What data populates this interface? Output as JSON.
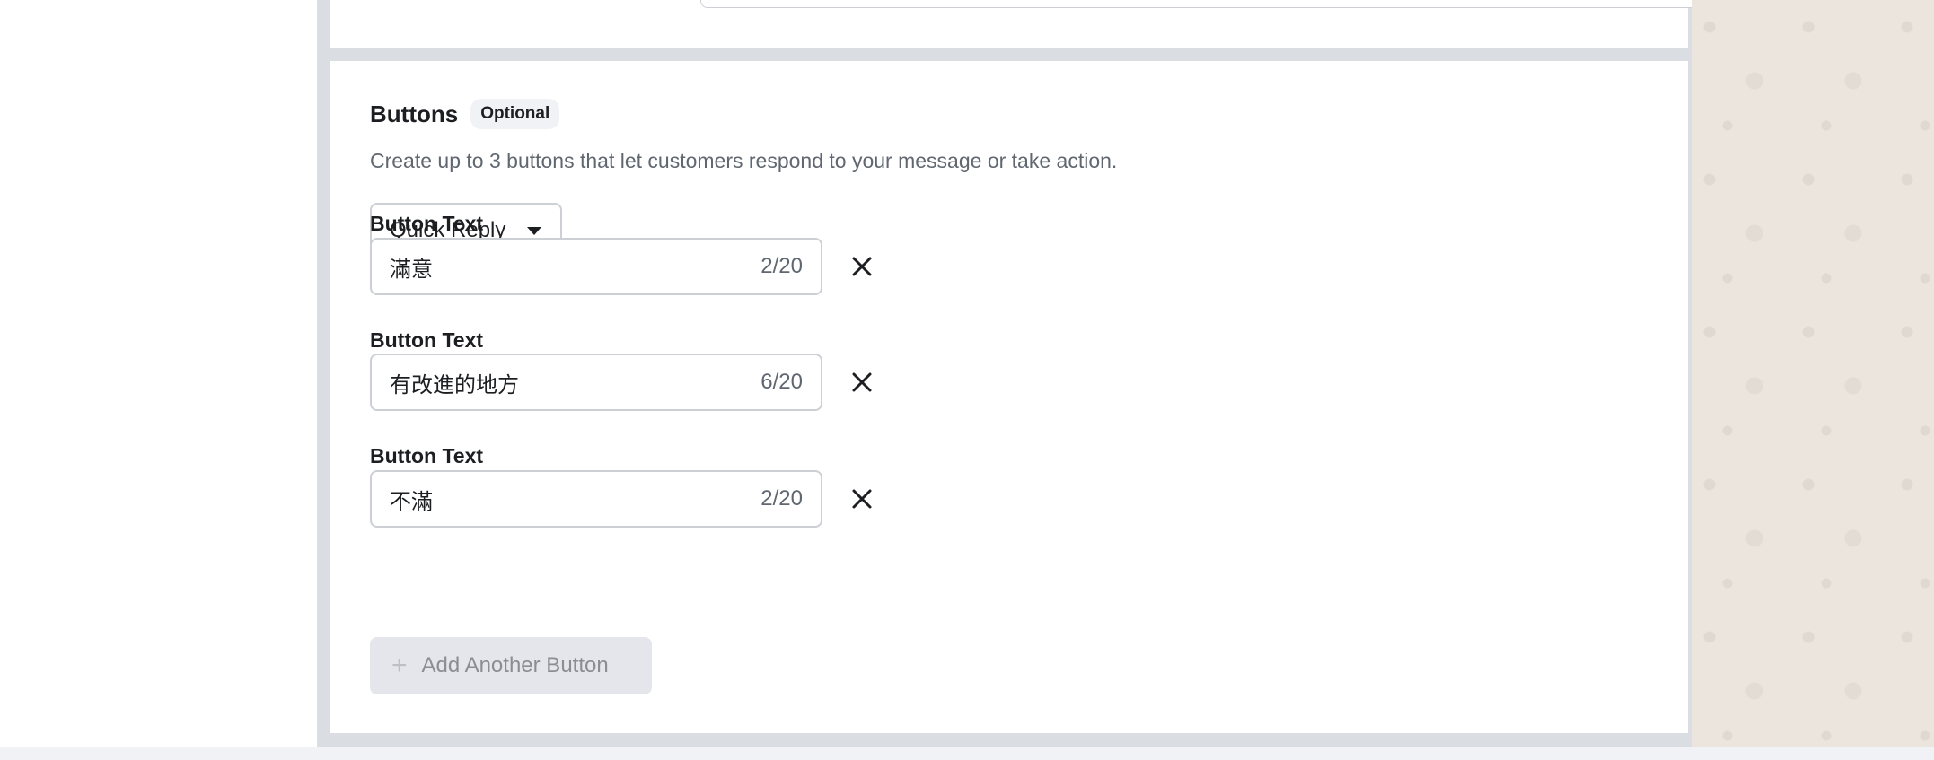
{
  "section": {
    "title": "Buttons",
    "badge": "Optional",
    "description": "Create up to 3 buttons that let customers respond to your message or take action."
  },
  "button_type": {
    "selected": "Quick Reply"
  },
  "buttons": [
    {
      "label": "Button Text",
      "value": "滿意",
      "count": "2/20"
    },
    {
      "label": "Button Text",
      "value": "有改進的地方",
      "count": "6/20"
    },
    {
      "label": "Button Text",
      "value": "不滿",
      "count": "2/20"
    }
  ],
  "add_button": {
    "label": "Add Another Button",
    "enabled": false
  },
  "icons": {
    "remove": "close-icon",
    "add": "plus-icon",
    "dropdown": "caret-down-icon"
  },
  "colors": {
    "text": "#1c1e21",
    "muted": "#606770",
    "border": "#ccd0d5",
    "disabled_bg": "#e4e6eb",
    "wallpaper": "#ece5dd"
  }
}
